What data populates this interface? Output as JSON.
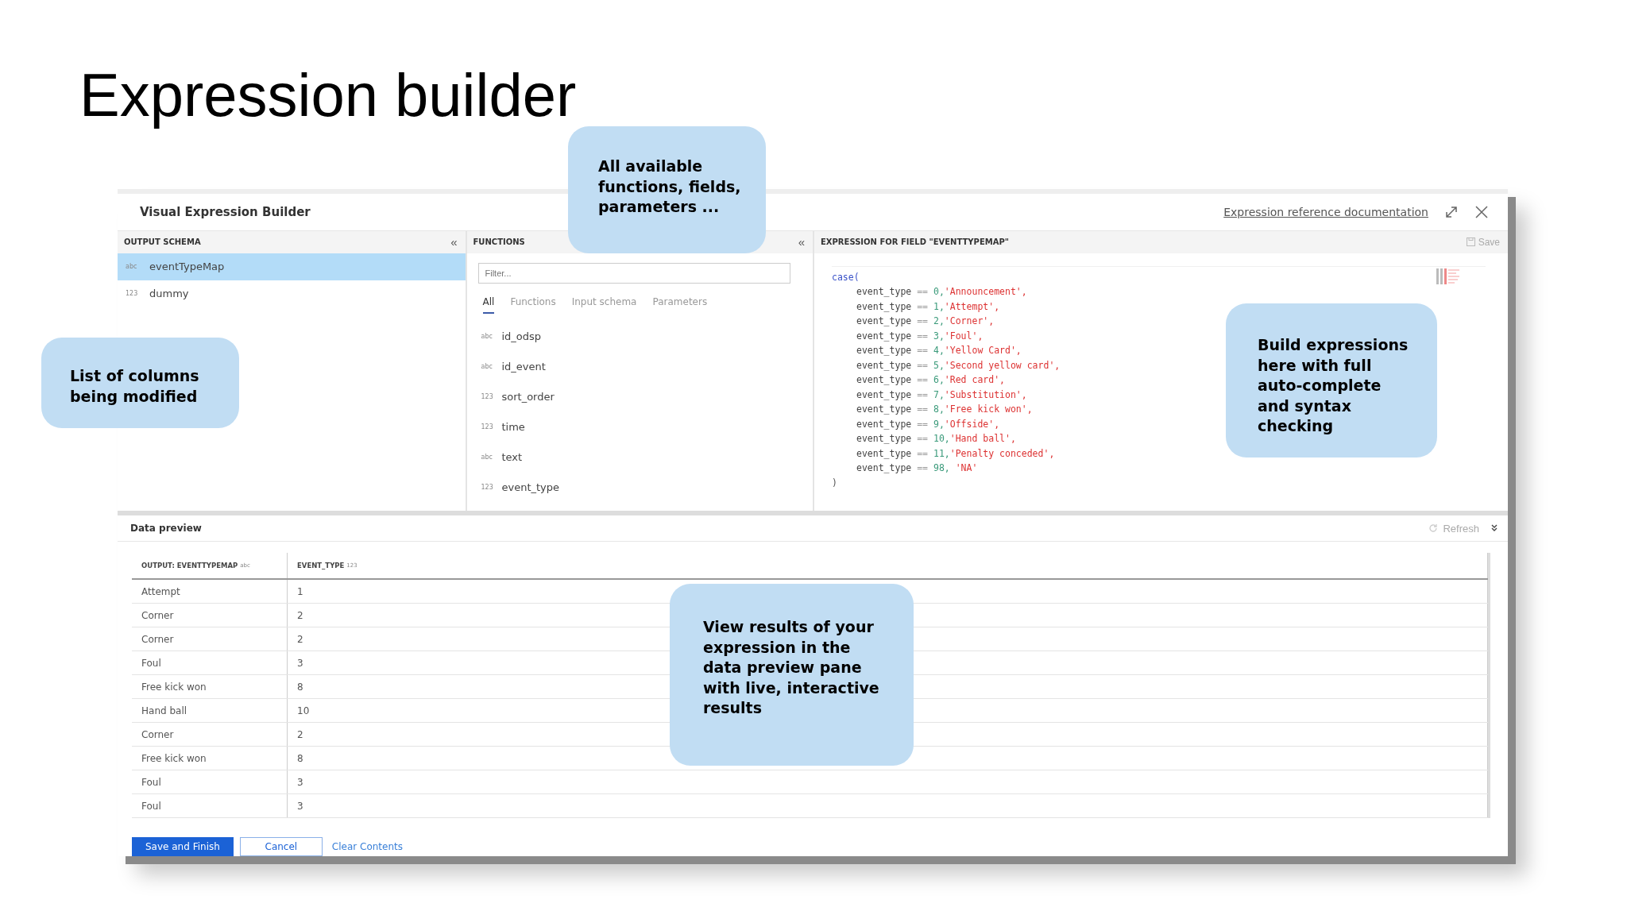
{
  "slide_title": "Expression builder",
  "window": {
    "title": "Visual Expression Builder",
    "doc_link": "Expression reference documentation"
  },
  "output_schema": {
    "header": "OUTPUT SCHEMA",
    "collapse": "«",
    "items": [
      {
        "type": "abc",
        "name": "eventTypeMap",
        "selected": true
      },
      {
        "type": "123",
        "name": "dummy",
        "selected": false
      }
    ]
  },
  "functions": {
    "header": "FUNCTIONS",
    "collapse": "«",
    "filter_placeholder": "Filter...",
    "tabs": [
      {
        "label": "All",
        "selected": true
      },
      {
        "label": "Functions",
        "selected": false
      },
      {
        "label": "Input schema",
        "selected": false
      },
      {
        "label": "Parameters",
        "selected": false
      }
    ],
    "items": [
      {
        "type": "abc",
        "name": "id_odsp"
      },
      {
        "type": "abc",
        "name": "id_event"
      },
      {
        "type": "123",
        "name": "sort_order"
      },
      {
        "type": "123",
        "name": "time"
      },
      {
        "type": "abc",
        "name": "text"
      },
      {
        "type": "123",
        "name": "event_type"
      }
    ]
  },
  "expression": {
    "header": "EXPRESSION FOR FIELD \"EVENTTYPEMAP\"",
    "save": "Save",
    "open": "case(",
    "close": ")",
    "lines": [
      {
        "field": "event_type",
        "op": "==",
        "number": "0,",
        "string": "'Announcement',"
      },
      {
        "field": "event_type",
        "op": "==",
        "number": "1,",
        "string": "'Attempt',"
      },
      {
        "field": "event_type",
        "op": "==",
        "number": "2,",
        "string": "'Corner',"
      },
      {
        "field": "event_type",
        "op": "==",
        "number": "3,",
        "string": "'Foul',"
      },
      {
        "field": "event_type",
        "op": "==",
        "number": "4,",
        "string": "'Yellow Card',"
      },
      {
        "field": "event_type",
        "op": "==",
        "number": "5,",
        "string": "'Second yellow card',"
      },
      {
        "field": "event_type",
        "op": "==",
        "number": "6,",
        "string": "'Red card',"
      },
      {
        "field": "event_type",
        "op": "==",
        "number": "7,",
        "string": "'Substitution',"
      },
      {
        "field": "event_type",
        "op": "==",
        "number": "8,",
        "string": "'Free kick won',"
      },
      {
        "field": "event_type",
        "op": "==",
        "number": "9,",
        "string": "'Offside',"
      },
      {
        "field": "event_type",
        "op": "==",
        "number": "10,",
        "string": "'Hand ball',"
      },
      {
        "field": "event_type",
        "op": "==",
        "number": "11,",
        "string": "'Penalty conceded',"
      },
      {
        "field": "event_type",
        "op": "==",
        "number": "98,",
        "string": " 'NA'"
      }
    ]
  },
  "data_preview": {
    "title": "Data preview",
    "refresh": "Refresh",
    "columns": [
      {
        "label": "OUTPUT: EVENTTYPEMAP",
        "type": "abc"
      },
      {
        "label": "EVENT_TYPE",
        "type": "123"
      }
    ],
    "rows": [
      [
        "Attempt",
        "1"
      ],
      [
        "Corner",
        "2"
      ],
      [
        "Corner",
        "2"
      ],
      [
        "Foul",
        "3"
      ],
      [
        "Free kick won",
        "8"
      ],
      [
        "Hand ball",
        "10"
      ],
      [
        "Corner",
        "2"
      ],
      [
        "Free kick won",
        "8"
      ],
      [
        "Foul",
        "3"
      ],
      [
        "Foul",
        "3"
      ]
    ]
  },
  "buttons": [
    {
      "kind": "primary",
      "label": "Save and Finish"
    },
    {
      "kind": "secondary",
      "label": "Cancel"
    },
    {
      "kind": "link",
      "label": "Clear Contents"
    }
  ],
  "callouts": [
    {
      "text": "All available functions, fields, parameters ..."
    },
    {
      "text": "List of columns being modified"
    },
    {
      "text": "Build expressions here with full auto-complete and syntax checking"
    },
    {
      "text": "View results of your expression in the data preview pane with live, interactive results"
    }
  ]
}
